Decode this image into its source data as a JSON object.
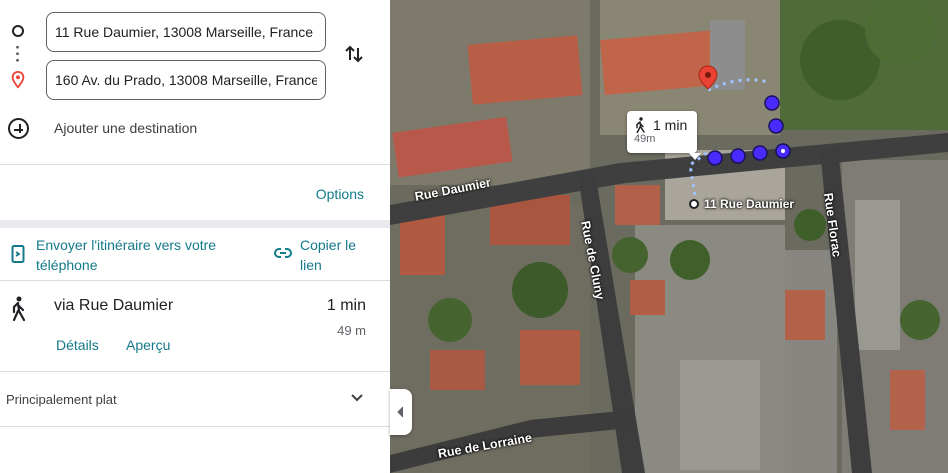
{
  "directions": {
    "origin_value": "11 Rue Daumier, 13008 Marseille, France",
    "destination_value": "160 Av. du Prado, 13008 Marseille, France",
    "add_destination_label": "Ajouter une destination",
    "swap_icon": "swap-vertical-icon"
  },
  "options_label": "Options",
  "share": {
    "send_label": "Envoyer l'itinéraire vers votre téléphone",
    "copy_label": "Copier le lien"
  },
  "route": {
    "via": "via Rue Daumier",
    "time": "1 min",
    "distance": "49 m",
    "details_label": "Détails",
    "overview_label": "Aperçu",
    "mode_icon": "walking-icon"
  },
  "elevation": {
    "label": "Principalement plat"
  },
  "map": {
    "streets": {
      "daumier": "Rue Daumier",
      "cluny": "Rue de Cluny",
      "florac": "Rue Florac",
      "lorraine": "Rue de Lorraine"
    },
    "destination_label": "11 Rue Daumier",
    "bubble": {
      "time": "1 min",
      "distance": "49m"
    },
    "colors": {
      "route_dots": "#4a2bff",
      "pin": "#ea4335",
      "link": "#137a8a"
    }
  }
}
